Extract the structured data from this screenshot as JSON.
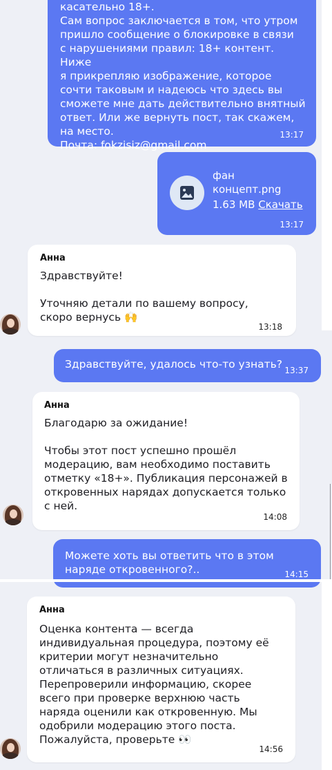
{
  "messages": [
    {
      "type": "outgoing",
      "text": "касательно 18+.\nСам вопрос заключается в том, что утром\nпришло сообщение о блокировке в связи\nс нарушениями правил: 18+ контент. Ниже\nя прикрепляю изображение, которое\nсочти таковым и надеюсь что здесь вы\nсможете мне дать действительно внятный\nответ. Или же вернуть пост, так скажем,\nна место.\nПочта: fokzisiz@gmail.com",
      "time": "13:17"
    },
    {
      "type": "outgoing-file",
      "file_name": "фан\nконцепт.png",
      "file_size": "1.63 MB",
      "download_label": "Скачать",
      "icon": "image-icon",
      "time": "13:17"
    },
    {
      "type": "incoming",
      "sender": "Анна",
      "text": "Здравствуйте!\n\nУточняю детали по вашему вопросу,\nскоро вернусь 🙌",
      "time": "13:18"
    },
    {
      "type": "outgoing",
      "text": "Здравствуйте, удалось что-то узнать?",
      "time": "13:37"
    },
    {
      "type": "incoming",
      "sender": "Анна",
      "text": "Благодарю за ожидание!\n\nЧтобы этот пост успешно прошёл\nмодерацию, вам необходимо поставить\nотметку «18+». Публикация персонажей в\nоткровенных нарядах допускается только\nс ней.",
      "time": "14:08"
    },
    {
      "type": "outgoing",
      "text": "Можете хоть вы ответить что в этом\nнаряде откровенного?..",
      "time": "14:15"
    },
    {
      "type": "incoming",
      "sender": "Анна",
      "text": "Оценка контента — всегда\nиндивидуальная процедура, поэтому её\nкритерии могут незначительно\nотличаться в различных ситуациях.\nПерепроверили информацию, скорее\nвсего при проверке верхнюю часть\nнаряда оценили как откровенную. Мы\nодобрили модерацию этого поста.\nПожалуйста, проверьте 👀",
      "time": "14:56"
    }
  ],
  "colors": {
    "outgoing_bubble": "#5b78f2",
    "incoming_bubble": "#ffffff",
    "chat_background": "#eef0f6"
  }
}
